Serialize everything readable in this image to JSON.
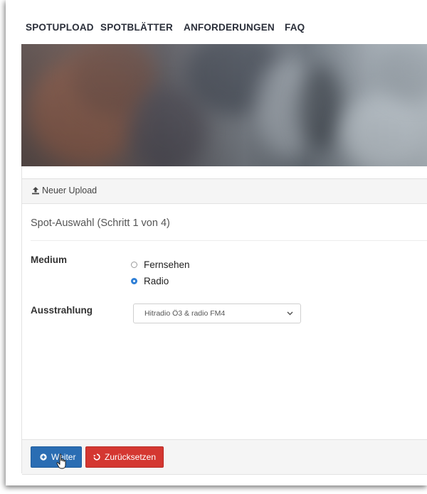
{
  "nav": {
    "items": [
      {
        "label": "SPOTUPLOAD"
      },
      {
        "label": "SPOTBLÄTTER"
      },
      {
        "label": "ANFORDERUNGEN"
      },
      {
        "label": "FAQ"
      }
    ]
  },
  "panel": {
    "header_label": "Neuer Upload",
    "step_title": "Spot-Auswahl (Schritt 1 von 4)"
  },
  "form": {
    "medium_label": "Medium",
    "medium_options": [
      {
        "label": "Fernsehen",
        "checked": false
      },
      {
        "label": "Radio",
        "checked": true
      }
    ],
    "ausstrahlung_label": "Ausstrahlung",
    "ausstrahlung_value": "Hitradio Ö3 & radio FM4"
  },
  "buttons": {
    "next_label": "Weiter",
    "reset_label": "Zurücksetzen"
  },
  "colors": {
    "primary": "#2a6db3",
    "danger": "#d43731",
    "radio_checked": "#2f7fd6"
  },
  "icons": {
    "upload": "upload-icon",
    "next": "circle-plus-icon",
    "reset": "undo-icon",
    "select": "chevron-down-icon",
    "cursor": "hand-pointer-icon"
  }
}
